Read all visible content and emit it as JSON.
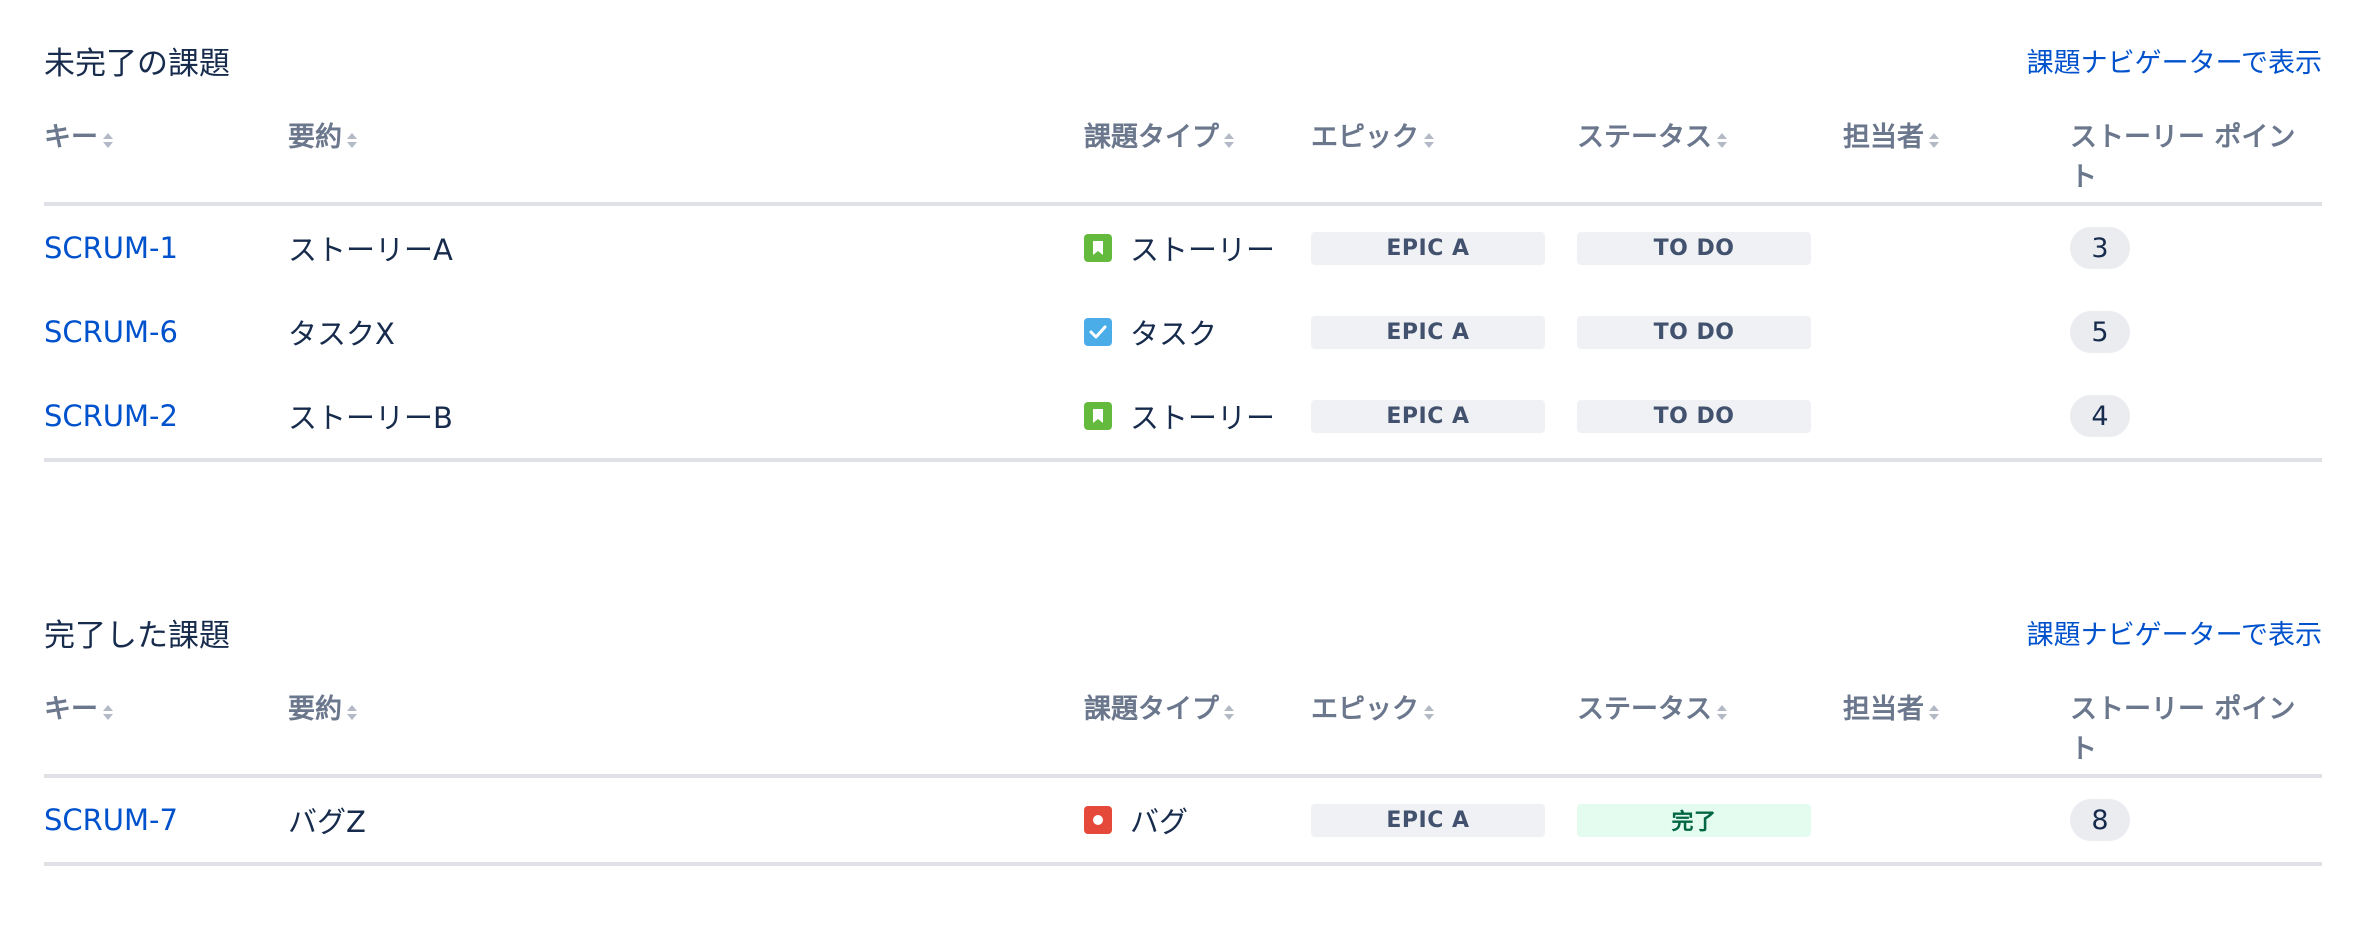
{
  "columns": {
    "key": "キー",
    "summary": "要約",
    "type": "課題タイプ",
    "epic": "エピック",
    "status": "ステータス",
    "assignee": "担当者",
    "points": "ストーリー ポイント"
  },
  "sections": [
    {
      "title": "未完了の課題",
      "nav_link": "課題ナビゲーターで表示",
      "rows": [
        {
          "key": "SCRUM-1",
          "summary": "ストーリーA",
          "type": "ストーリー",
          "type_icon": "story-icon",
          "epic": "EPIC A",
          "status": "TO DO",
          "assignee": "",
          "points": "3"
        },
        {
          "key": "SCRUM-6",
          "summary": "タスクX",
          "type": "タスク",
          "type_icon": "task-icon",
          "epic": "EPIC A",
          "status": "TO DO",
          "assignee": "",
          "points": "5"
        },
        {
          "key": "SCRUM-2",
          "summary": "ストーリーB",
          "type": "ストーリー",
          "type_icon": "story-icon",
          "epic": "EPIC A",
          "status": "TO DO",
          "assignee": "",
          "points": "4"
        }
      ]
    },
    {
      "title": "完了した課題",
      "nav_link": "課題ナビゲーターで表示",
      "rows": [
        {
          "key": "SCRUM-7",
          "summary": "バグZ",
          "type": "バグ",
          "type_icon": "bug-icon",
          "epic": "EPIC A",
          "status": "完了",
          "assignee": "",
          "points": "8"
        }
      ]
    }
  ],
  "colors": {
    "link": "#0052cc",
    "story": "#63ba3c",
    "task": "#4bade8",
    "bug": "#e5493a",
    "done_bg": "#e3fcef",
    "done_text": "#006644"
  }
}
